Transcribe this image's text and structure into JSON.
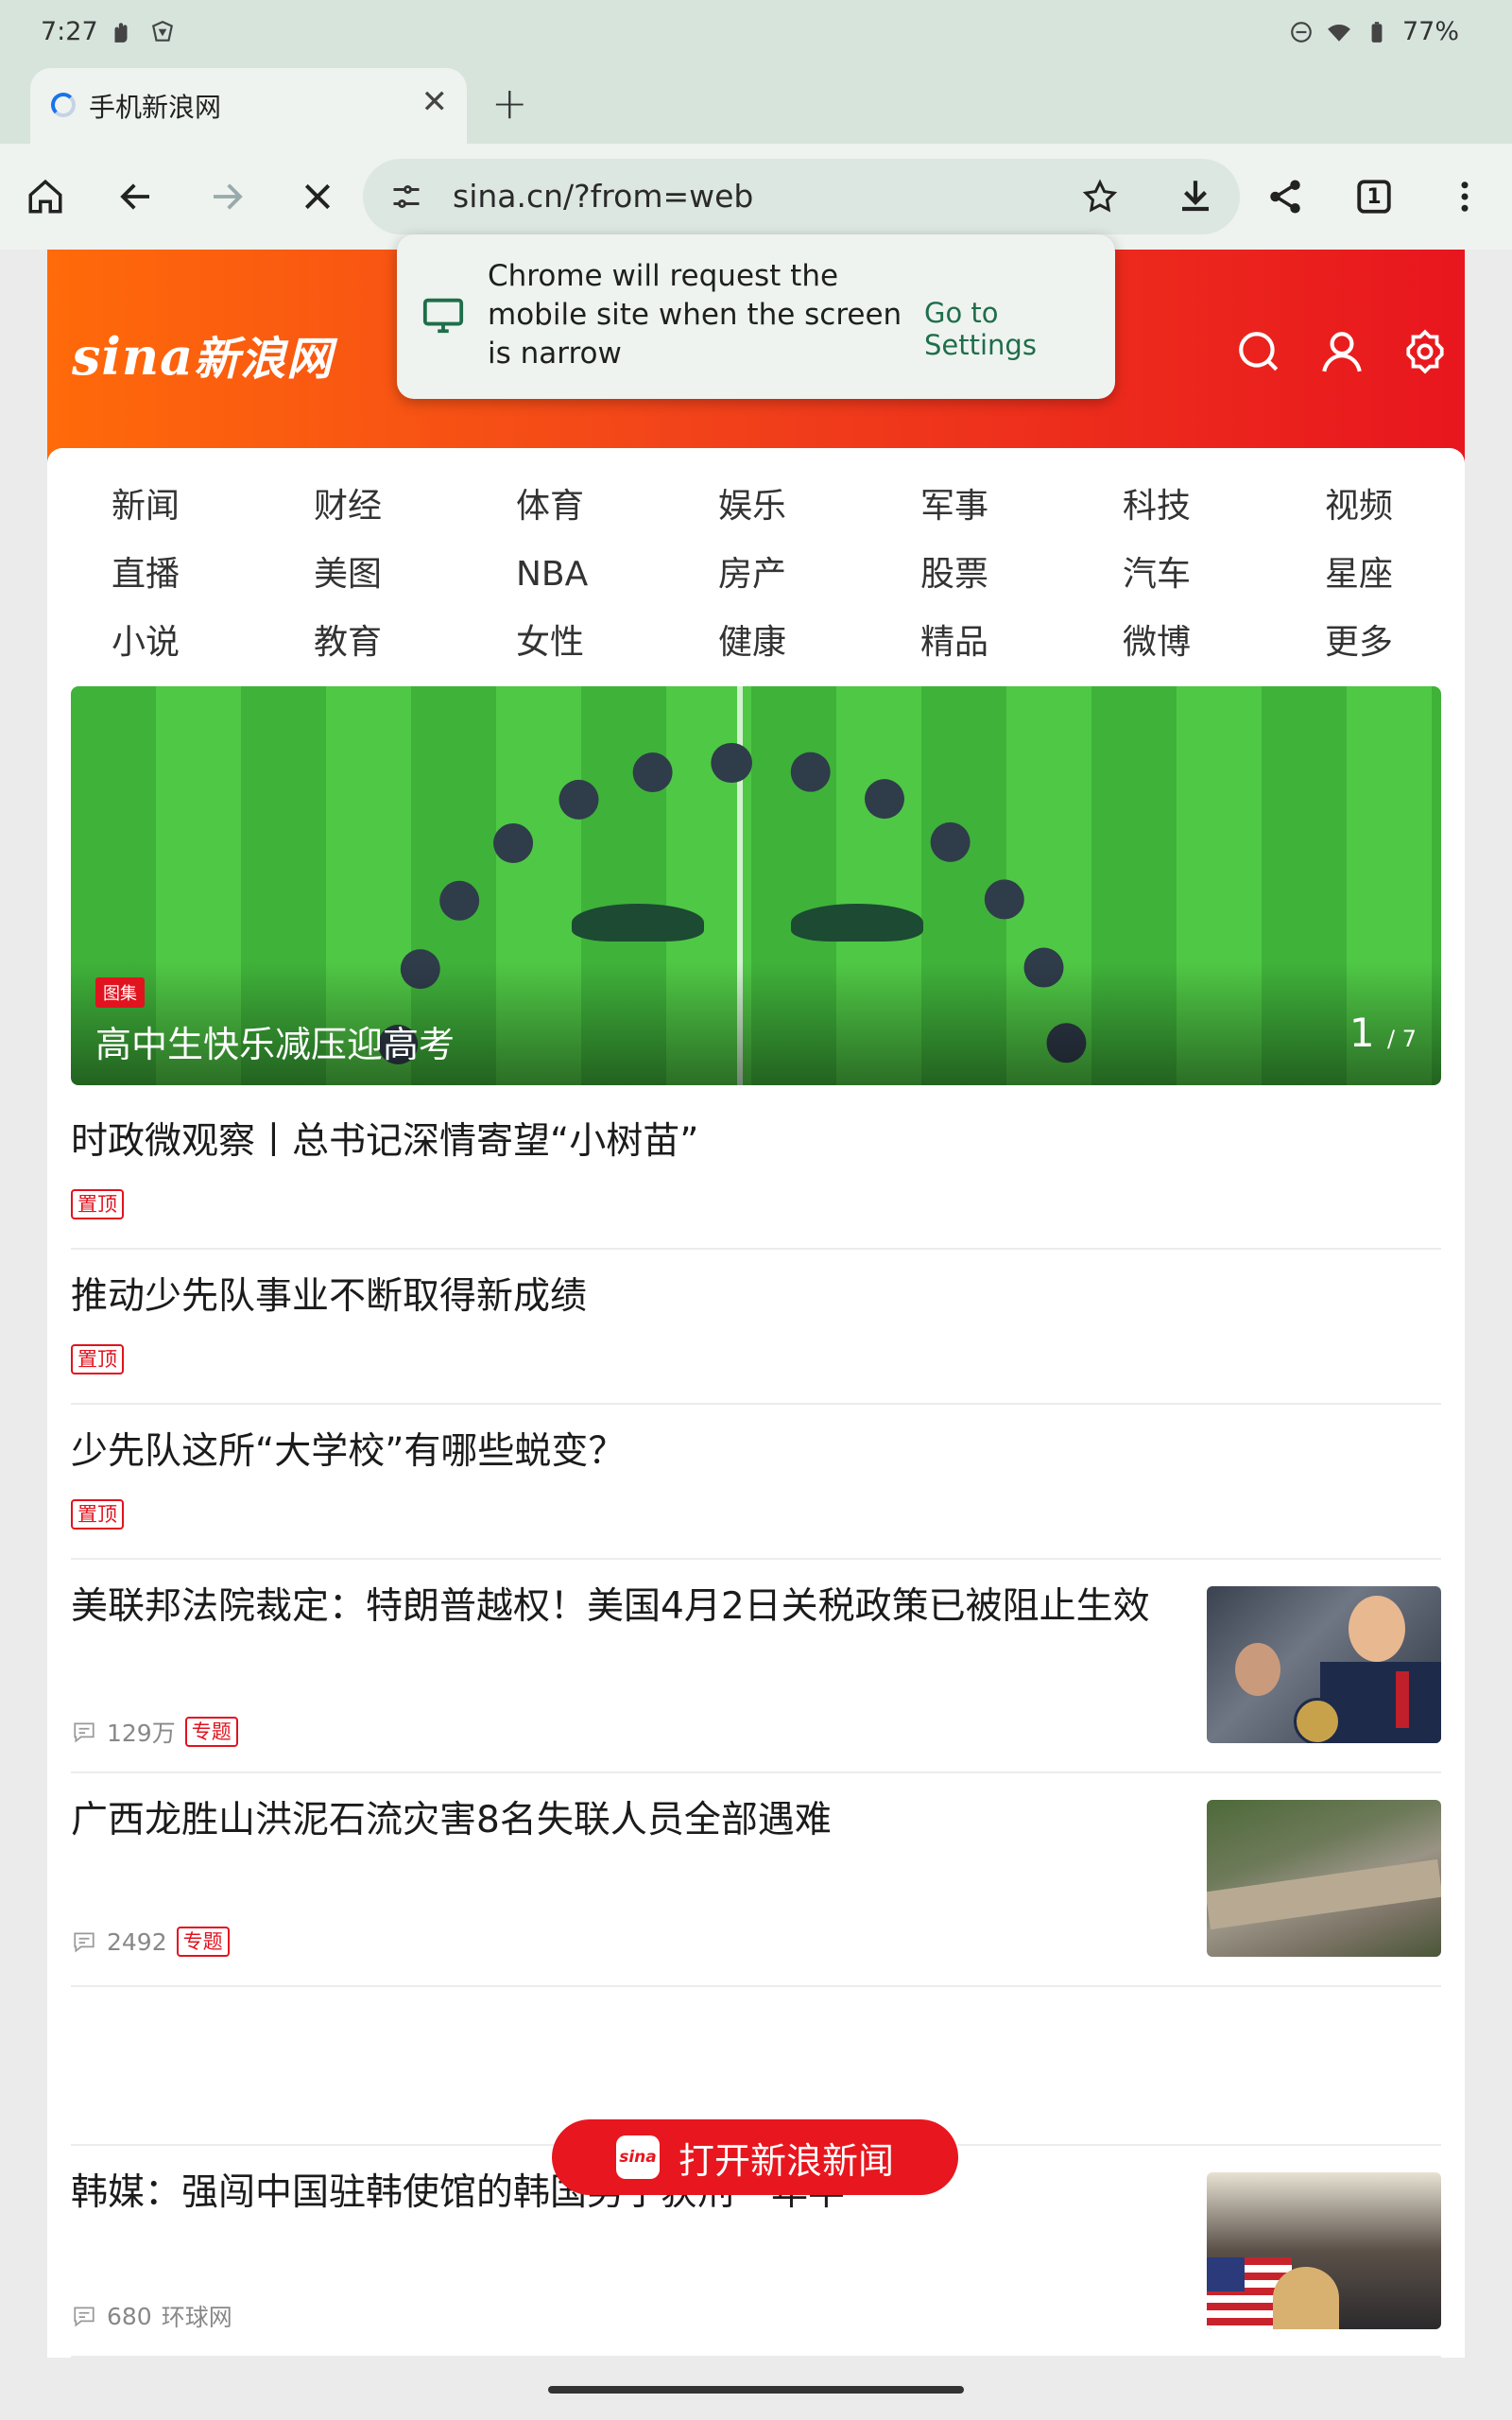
{
  "status_bar": {
    "time": "7:27",
    "battery": "77%"
  },
  "tab": {
    "title": "手机新浪网"
  },
  "omnibox": {
    "url": "sina.cn/?from=web",
    "tab_count": "1"
  },
  "popup": {
    "message": "Chrome will request the mobile site when the screen is narrow",
    "action": "Go to Settings"
  },
  "header": {
    "logo_latin": "sina",
    "logo_cn": "新浪网"
  },
  "nav": {
    "rows": [
      [
        "新闻",
        "财经",
        "体育",
        "娱乐",
        "军事",
        "科技",
        "视频"
      ],
      [
        "直播",
        "美图",
        "NBA",
        "房产",
        "股票",
        "汽车",
        "星座"
      ],
      [
        "小说",
        "教育",
        "女性",
        "健康",
        "精品",
        "微博",
        "更多"
      ]
    ]
  },
  "hero": {
    "tag": "图集",
    "caption": "高中生快乐减压迎高考",
    "index": "1",
    "total": "/ 7"
  },
  "news": [
    {
      "title": "时政微观察丨总书记深情寄望“小树苗”",
      "badge": "置顶"
    },
    {
      "title": "推动少先队事业不断取得新成绩",
      "badge": "置顶"
    },
    {
      "title": "少先队这所“大学校”有哪些蜕变？",
      "badge": "置顶"
    },
    {
      "title": "美联邦法院裁定：特朗普越权！美国4月2日关税政策已被阻止生效",
      "comments": "129万",
      "badge": "专题"
    },
    {
      "title": "广西龙胜山洪泥石流灾害8名失联人员全部遇难",
      "comments": "2492",
      "badge": "专题"
    },
    {
      "title": "韩媒：强闯中国驻韩使馆的韩国男子获刑一年半",
      "comments": "680",
      "source": "环球网"
    }
  ],
  "open_app": {
    "label": "打开新浪新闻",
    "app_icon_text": "sina"
  },
  "colors": {
    "brand_red": "#e8161e",
    "brand_orange": "#ff6a0a",
    "chrome_green_bg": "#d6e4dc"
  }
}
